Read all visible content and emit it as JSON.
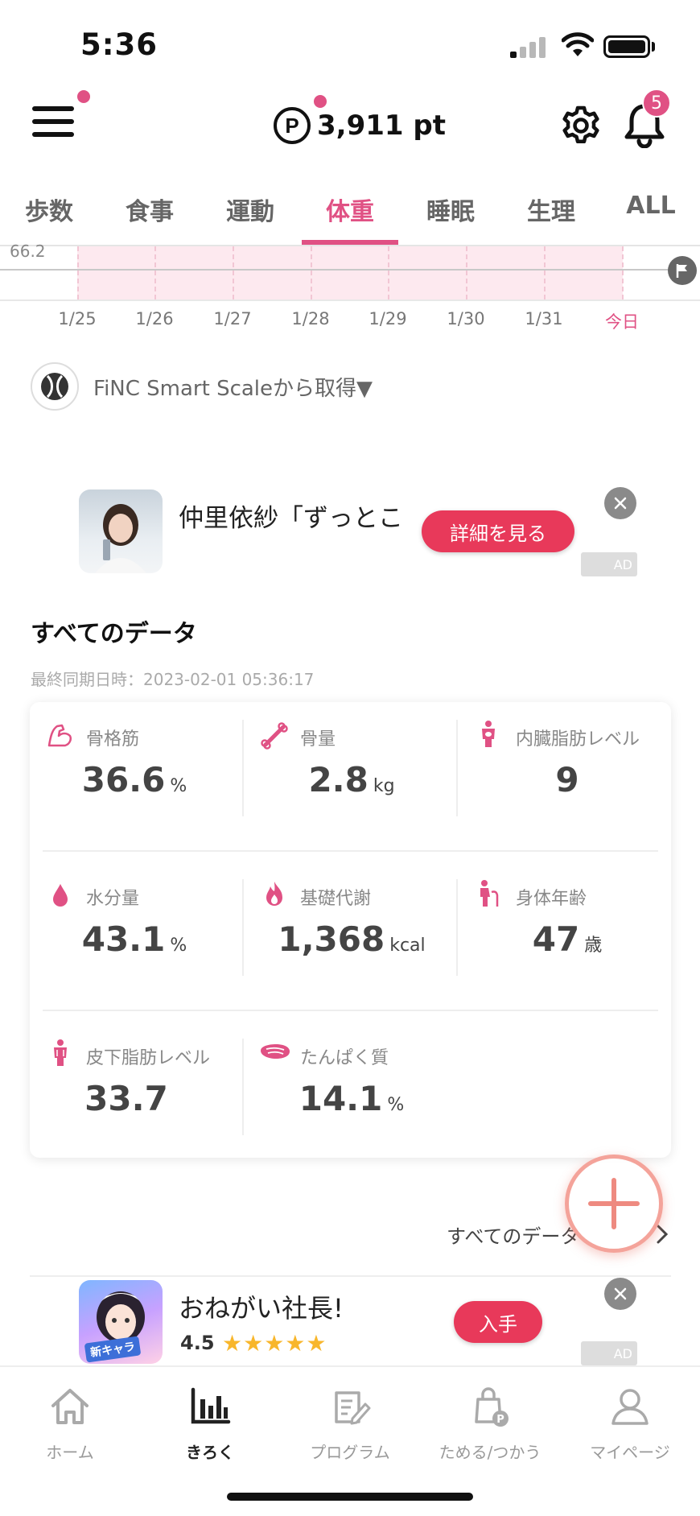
{
  "status_bar": {
    "time": "5:36"
  },
  "header": {
    "points": "3,911 pt",
    "point_symbol": "P",
    "notification_count": "5"
  },
  "tabs": [
    {
      "label": "歩数"
    },
    {
      "label": "食事"
    },
    {
      "label": "運動"
    },
    {
      "label": "体重",
      "active": true
    },
    {
      "label": "睡眠"
    },
    {
      "label": "生理"
    },
    {
      "label": "ALL"
    }
  ],
  "chart": {
    "y_value_label": "66.2",
    "dates": [
      "1/25",
      "1/26",
      "1/27",
      "1/28",
      "1/29",
      "1/30",
      "1/31",
      "今日"
    ]
  },
  "source": {
    "text": "FiNC Smart Scaleから取得▼"
  },
  "ad1": {
    "title": "仲里依紗「ずっとこ",
    "cta": "詳細を見る",
    "ad_label": "AD"
  },
  "section": {
    "title": "すべてのデータ",
    "sync_time": "最終同期日時：2023-02-01 05:36:17"
  },
  "metrics": [
    {
      "label": "骨格筋",
      "value": "36.6",
      "unit": "%",
      "icon": "muscle-icon"
    },
    {
      "label": "骨量",
      "value": "2.8",
      "unit": "kg",
      "icon": "bone-icon"
    },
    {
      "label": "内臓脂肪レベル",
      "value": "9",
      "unit": "",
      "icon": "visceral-fat-icon"
    },
    {
      "label": "水分量",
      "value": "43.1",
      "unit": "%",
      "icon": "water-drop-icon"
    },
    {
      "label": "基礎代謝",
      "value": "1,368",
      "unit": "kcal",
      "icon": "flame-icon"
    },
    {
      "label": "身体年齢",
      "value": "47",
      "unit": "歳",
      "icon": "body-age-icon"
    },
    {
      "label": "皮下脂肪レベル",
      "value": "33.7",
      "unit": "",
      "icon": "subcutaneous-fat-icon"
    },
    {
      "label": "たんぱく質",
      "value": "14.1",
      "unit": "%",
      "icon": "protein-meat-icon"
    }
  ],
  "see_all": {
    "label": "すべてのデータ"
  },
  "ad2": {
    "title": "おねがい社長!",
    "rating": "4.5",
    "stars": "★★★★★",
    "thumb_tag": "新キャラ",
    "cta": "入手",
    "ad_label": "AD"
  },
  "bottom_nav": [
    {
      "label": "ホーム"
    },
    {
      "label": "きろく",
      "active": true
    },
    {
      "label": "プログラム"
    },
    {
      "label": "ためる/つかう"
    },
    {
      "label": "マイページ"
    }
  ],
  "colors": {
    "accent": "#e05184",
    "cta": "#e8395a",
    "fab_ring": "#f4a39a"
  }
}
